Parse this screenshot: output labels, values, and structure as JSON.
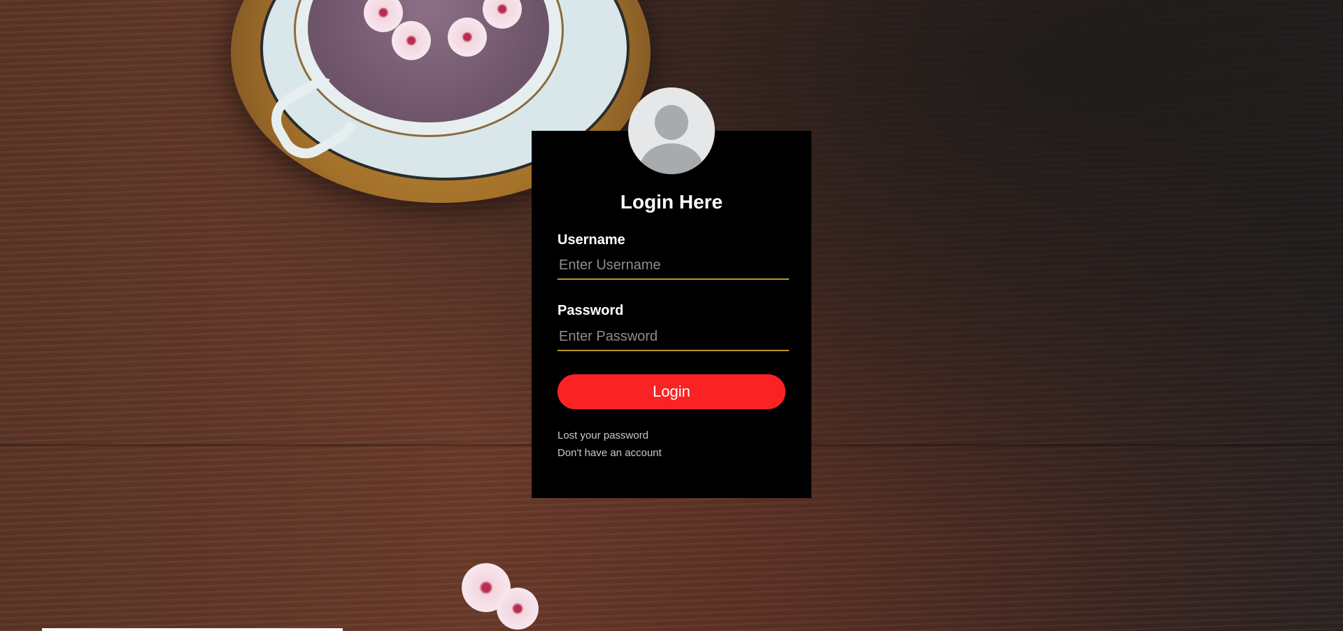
{
  "colors": {
    "card_background": "#000000",
    "button_color": "#fb2224",
    "input_underline": "#b8962e",
    "avatar_background": "#e6e7e8"
  },
  "icons": {
    "avatar": "user-avatar-icon"
  },
  "login": {
    "title": "Login Here",
    "username_label": "Username",
    "username_placeholder": "Enter Username",
    "password_label": "Password",
    "password_placeholder": "Enter Password",
    "submit_label": "Login",
    "lost_password_link": "Lost your password",
    "signup_link": "Don't have an account"
  }
}
